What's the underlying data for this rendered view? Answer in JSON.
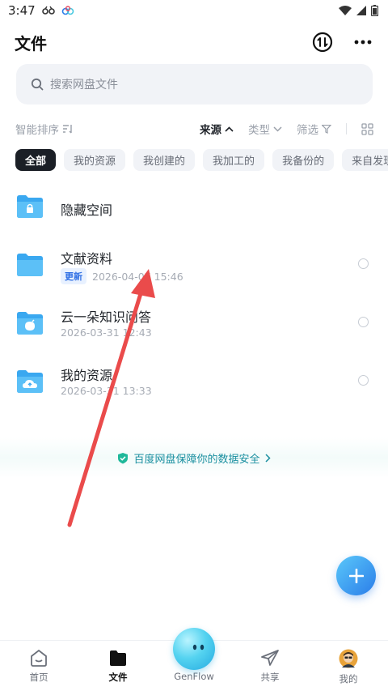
{
  "status_bar": {
    "time": "3:47"
  },
  "header": {
    "title": "文件"
  },
  "search": {
    "placeholder": "搜索网盘文件"
  },
  "sort_bar": {
    "sort_label": "智能排序",
    "filters": [
      {
        "label": "来源",
        "active": true
      },
      {
        "label": "类型",
        "active": false
      },
      {
        "label": "筛选",
        "active": false
      }
    ]
  },
  "chips": [
    "全部",
    "我的资源",
    "我创建的",
    "我加工的",
    "我备份的",
    "来自发现"
  ],
  "files": [
    {
      "name": "隐藏空间",
      "meta": "",
      "badge": "",
      "icon": "lock-folder-icon"
    },
    {
      "name": "文献资料",
      "meta": "2026-04-07 15:46",
      "badge": "更新",
      "icon": "folder-icon"
    },
    {
      "name": "云一朵知识问答",
      "meta": "2026-03-31 12:43",
      "badge": "",
      "icon": "knowledge-folder-icon"
    },
    {
      "name": "我的资源",
      "meta": "2026-03-31 13:33",
      "badge": "",
      "icon": "cloud-folder-icon"
    }
  ],
  "security": {
    "text": "百度网盘保障你的数据安全"
  },
  "bottom_nav": {
    "items": [
      {
        "label": "首页",
        "active": false
      },
      {
        "label": "文件",
        "active": true
      },
      {
        "label": "GenFlow",
        "active": false
      },
      {
        "label": "共享",
        "active": false
      },
      {
        "label": "我的",
        "active": false
      }
    ]
  },
  "colors": {
    "accent": "#2b7de9",
    "folder": "#3aa8f0",
    "annotation_arrow": "#ea4b4b"
  }
}
